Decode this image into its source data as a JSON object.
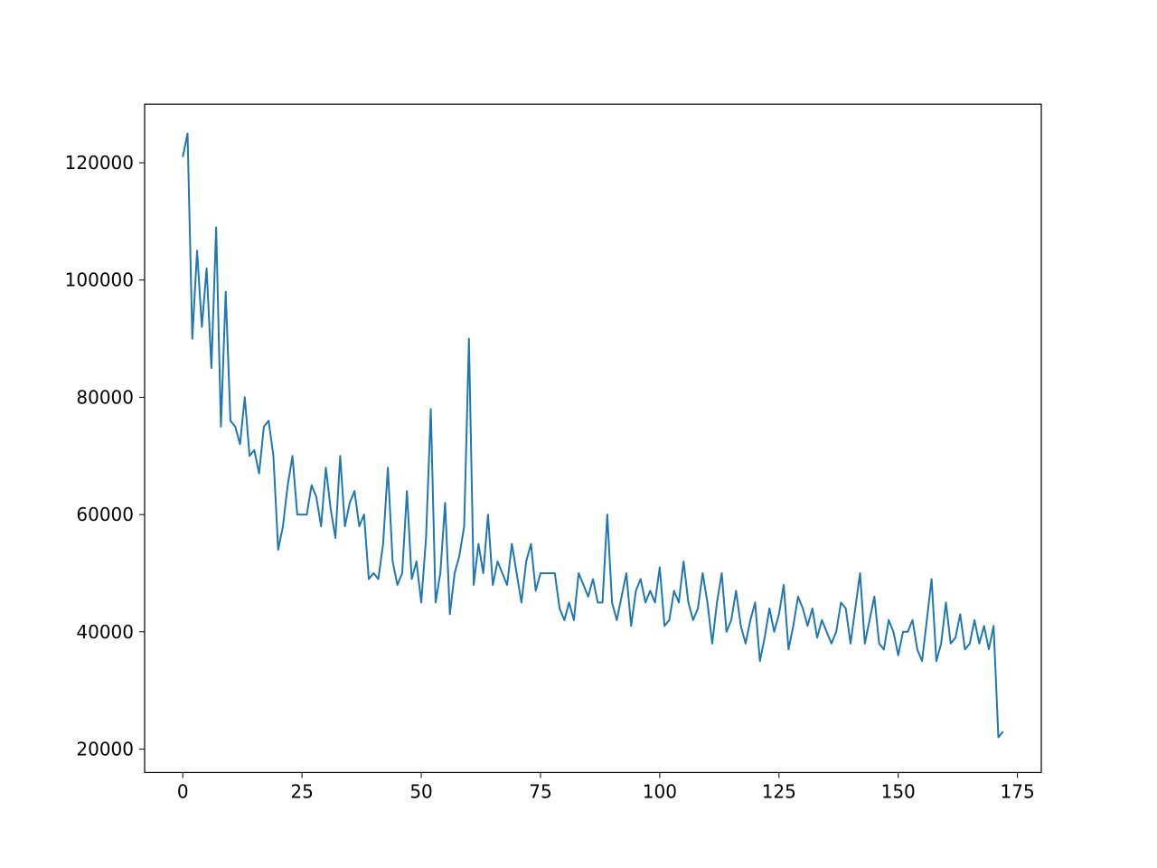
{
  "chart_data": {
    "type": "line",
    "title": "",
    "xlabel": "",
    "ylabel": "",
    "xlim": [
      -8,
      180
    ],
    "ylim": [
      16000,
      130000
    ],
    "x_ticks": [
      0,
      25,
      50,
      75,
      100,
      125,
      150,
      175
    ],
    "y_ticks": [
      20000,
      40000,
      60000,
      80000,
      100000,
      120000
    ],
    "x_tick_labels": [
      "0",
      "25",
      "50",
      "75",
      "100",
      "125",
      "150",
      "175"
    ],
    "y_tick_labels": [
      "20000",
      "40000",
      "60000",
      "80000",
      "100000",
      "120000"
    ],
    "line_color": "#1f77b4",
    "x": [
      0,
      1,
      2,
      3,
      4,
      5,
      6,
      7,
      8,
      9,
      10,
      11,
      12,
      13,
      14,
      15,
      16,
      17,
      18,
      19,
      20,
      21,
      22,
      23,
      24,
      25,
      26,
      27,
      28,
      29,
      30,
      31,
      32,
      33,
      34,
      35,
      36,
      37,
      38,
      39,
      40,
      41,
      42,
      43,
      44,
      45,
      46,
      47,
      48,
      49,
      50,
      51,
      52,
      53,
      54,
      55,
      56,
      57,
      58,
      59,
      60,
      61,
      62,
      63,
      64,
      65,
      66,
      67,
      68,
      69,
      70,
      71,
      72,
      73,
      74,
      75,
      76,
      77,
      78,
      79,
      80,
      81,
      82,
      83,
      84,
      85,
      86,
      87,
      88,
      89,
      90,
      91,
      92,
      93,
      94,
      95,
      96,
      97,
      98,
      99,
      100,
      101,
      102,
      103,
      104,
      105,
      106,
      107,
      108,
      109,
      110,
      111,
      112,
      113,
      114,
      115,
      116,
      117,
      118,
      119,
      120,
      121,
      122,
      123,
      124,
      125,
      126,
      127,
      128,
      129,
      130,
      131,
      132,
      133,
      134,
      135,
      136,
      137,
      138,
      139,
      140,
      141,
      142,
      143,
      144,
      145,
      146,
      147,
      148,
      149,
      150,
      151,
      152,
      153,
      154,
      155,
      156,
      157,
      158,
      159,
      160,
      161,
      162,
      163,
      164,
      165,
      166,
      167,
      168,
      169,
      170,
      171,
      172
    ],
    "values": [
      121000,
      125000,
      90000,
      105000,
      92000,
      102000,
      85000,
      109000,
      75000,
      98000,
      76000,
      75000,
      72000,
      80000,
      70000,
      71000,
      67000,
      75000,
      76000,
      70000,
      54000,
      58000,
      65000,
      70000,
      60000,
      60000,
      60000,
      65000,
      63000,
      58000,
      68000,
      61000,
      56000,
      70000,
      58000,
      62000,
      64000,
      58000,
      60000,
      49000,
      50000,
      49000,
      55000,
      68000,
      52000,
      48000,
      50000,
      64000,
      49000,
      52000,
      45000,
      56000,
      78000,
      45000,
      50000,
      62000,
      43000,
      50000,
      53000,
      58000,
      90000,
      48000,
      55000,
      50000,
      60000,
      48000,
      52000,
      50000,
      48000,
      55000,
      50000,
      45000,
      52000,
      55000,
      47000,
      50000,
      50000,
      50000,
      50000,
      44000,
      42000,
      45000,
      42000,
      50000,
      48000,
      46000,
      49000,
      45000,
      45000,
      60000,
      45000,
      42000,
      46000,
      50000,
      41000,
      47000,
      49000,
      45000,
      47000,
      45000,
      51000,
      41000,
      42000,
      47000,
      45000,
      52000,
      45000,
      42000,
      44000,
      50000,
      45000,
      38000,
      45000,
      50000,
      40000,
      42000,
      47000,
      41000,
      38000,
      42000,
      45000,
      35000,
      39000,
      44000,
      40000,
      43000,
      48000,
      37000,
      41000,
      46000,
      44000,
      41000,
      44000,
      39000,
      42000,
      40000,
      38000,
      40000,
      45000,
      44000,
      38000,
      44000,
      50000,
      38000,
      42000,
      46000,
      38000,
      37000,
      42000,
      40000,
      36000,
      40000,
      40000,
      42000,
      37000,
      35000,
      42000,
      49000,
      35000,
      38000,
      45000,
      38000,
      39000,
      43000,
      37000,
      38000,
      42000,
      38000,
      41000,
      37000,
      41000,
      22000,
      23000
    ]
  }
}
